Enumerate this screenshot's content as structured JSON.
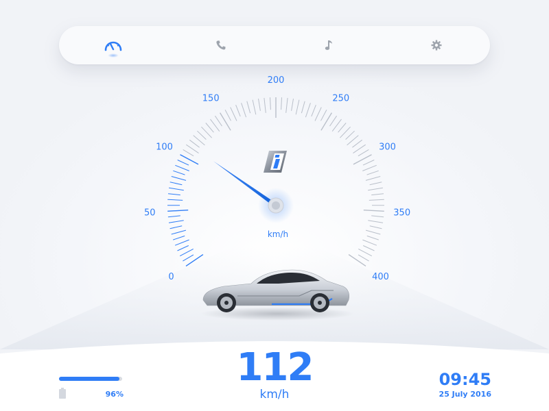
{
  "nav": {
    "items": [
      {
        "icon": "speedometer-icon",
        "active": true
      },
      {
        "icon": "phone-icon",
        "active": false
      },
      {
        "icon": "music-note-icon",
        "active": false
      },
      {
        "icon": "gear-icon",
        "active": false
      }
    ]
  },
  "gauge": {
    "labels": [
      "0",
      "50",
      "100",
      "150",
      "200",
      "250",
      "300",
      "350",
      "400"
    ],
    "min": 0,
    "max": 400,
    "unit": "km/h",
    "needle_value": 112
  },
  "speed": {
    "value": "112",
    "unit": "km/h"
  },
  "battery": {
    "percent_label": "96%",
    "level": 0.96
  },
  "clock": {
    "time": "09:45",
    "date": "25 July 2016"
  },
  "colors": {
    "accent": "#2f7df6",
    "background": "#f6f8fb",
    "inactive_icon": "#9ea4ad",
    "tick": "#b9bfc9"
  }
}
